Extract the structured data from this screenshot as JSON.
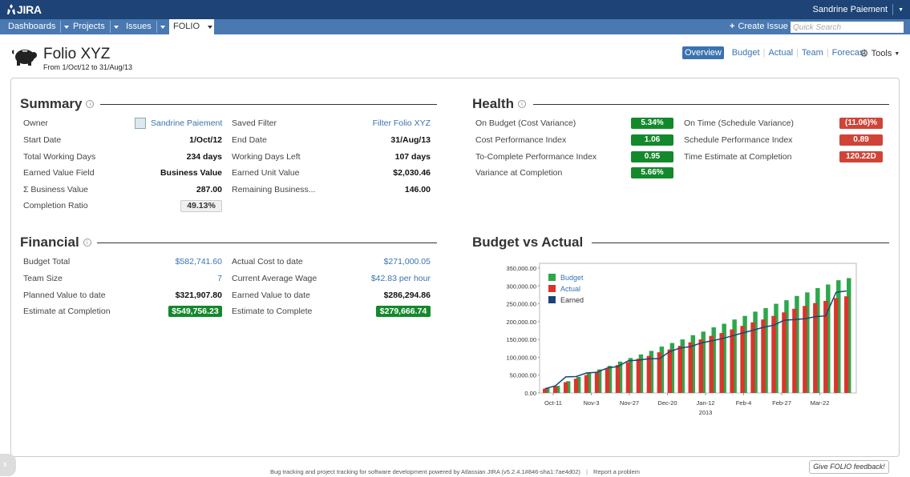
{
  "header": {
    "logo": "JIRA",
    "user": "Sandrine Paiement",
    "nav": [
      "Dashboards",
      "Projects",
      "Issues",
      "FOLIO"
    ],
    "create_issue": "Create Issue",
    "search_placeholder": "Quick Search"
  },
  "page": {
    "title": "Folio XYZ",
    "subtitle": "From 1/Oct/12 to 31/Aug/13",
    "tabs": [
      "Overview",
      "Budget",
      "Actual",
      "Team",
      "Forecast"
    ],
    "tools": "Tools"
  },
  "summary": {
    "title": "Summary",
    "left": [
      {
        "label": "Owner",
        "value": "Sandrine Paiement"
      },
      {
        "label": "Start Date",
        "value": "1/Oct/12"
      },
      {
        "label": "Total Working Days",
        "value": "234 days"
      },
      {
        "label": "Earned Value Field",
        "value": "Business Value"
      },
      {
        "label": "Σ Business Value",
        "value": "287.00"
      },
      {
        "label": "Completion Ratio",
        "value": "49.13%"
      }
    ],
    "right": [
      {
        "label": "Saved Filter",
        "value": "Filter Folio XYZ"
      },
      {
        "label": "End Date",
        "value": "31/Aug/13"
      },
      {
        "label": "Working Days Left",
        "value": "107 days"
      },
      {
        "label": "Earned Unit Value",
        "value": "$2,030.46"
      },
      {
        "label": "Remaining Business...",
        "value": "146.00"
      }
    ]
  },
  "health": {
    "title": "Health",
    "left": [
      {
        "label": "On Budget (Cost Variance)",
        "value": "5.34%"
      },
      {
        "label": "Cost Performance Index",
        "value": "1.06"
      },
      {
        "label": "To-Complete Performance Index",
        "value": "0.95"
      },
      {
        "label": "Variance at Completion",
        "value": "5.66%"
      }
    ],
    "right": [
      {
        "label": "On Time (Schedule Variance)",
        "value": "(11.06)%"
      },
      {
        "label": "Schedule Performance Index",
        "value": "0.89"
      },
      {
        "label": "Time Estimate at Completion",
        "value": "120.22D"
      }
    ]
  },
  "financial": {
    "title": "Financial",
    "left": [
      {
        "label": "Budget Total",
        "value": "$582,741.60"
      },
      {
        "label": "Team Size",
        "value": "7"
      },
      {
        "label": "Planned Value to date",
        "value": "$321,907.80"
      },
      {
        "label": "Estimate at Completion",
        "value": "$549,756.23"
      }
    ],
    "right": [
      {
        "label": "Actual Cost to date",
        "value": "$271,000.05"
      },
      {
        "label": "Current Average Wage",
        "value": "$42.83 per hour"
      },
      {
        "label": "Earned Value to date",
        "value": "$286,294.86"
      },
      {
        "label": "Estimate to Complete",
        "value": "$279,666.74"
      }
    ]
  },
  "colors": {
    "green": "#14892c",
    "red": "#d04437",
    "link": "#3b73af",
    "bar_budget": "#2ca84a",
    "bar_actual": "#d9362b",
    "line_earned": "#1d4377"
  },
  "chart_data": {
    "type": "bar",
    "title": "Budget vs Actual",
    "ylim": [
      0,
      350000
    ],
    "yticks": [
      "350,000.00",
      "300,000.00",
      "250,000.00",
      "200,000.00",
      "150,000.00",
      "100,000.00",
      "50,000.00",
      "0.00"
    ],
    "xticks": [
      "Oct-11",
      "Nov-3",
      "Nov-27",
      "Dec-20",
      "Jan-12",
      "Feb-4",
      "Feb-27",
      "Mar-22"
    ],
    "xtick_sub": "2013",
    "legend": [
      "Budget",
      "Actual",
      "Earned"
    ],
    "legend_position": "top-left",
    "grid": false,
    "series": [
      {
        "name": "Budget",
        "values": [
          14000,
          20000,
          33000,
          45000,
          56000,
          66000,
          76000,
          88000,
          98000,
          108000,
          118000,
          130000,
          140000,
          150000,
          162000,
          172000,
          184000,
          194000,
          206000,
          216000,
          228000,
          238000,
          250000,
          260000,
          272000,
          282000,
          294000,
          304000,
          316000,
          322000
        ]
      },
      {
        "name": "Actual",
        "values": [
          12000,
          18000,
          30000,
          40000,
          50000,
          58000,
          68000,
          78000,
          86000,
          96000,
          104000,
          114000,
          122000,
          132000,
          142000,
          150000,
          160000,
          168000,
          178000,
          188000,
          198000,
          206000,
          216000,
          226000,
          236000,
          244000,
          252000,
          258000,
          266000,
          271000
        ]
      },
      {
        "name": "Earned",
        "values": [
          12000,
          20000,
          45000,
          46000,
          56000,
          58000,
          70000,
          74000,
          90000,
          92000,
          96000,
          96000,
          116000,
          126000,
          130000,
          140000,
          146000,
          152000,
          160000,
          168000,
          176000,
          184000,
          190000,
          204000,
          206000,
          208000,
          214000,
          216000,
          282000,
          286000
        ]
      }
    ]
  },
  "chart_title": "Budget vs Actual",
  "footer": {
    "text": "Bug tracking and project tracking for software development powered by Atlassian JIRA (v5.2.4.1#846-sha1:7ae4d02)",
    "report": "Report a problem",
    "feedback": "Give FOLIO feedback!"
  }
}
